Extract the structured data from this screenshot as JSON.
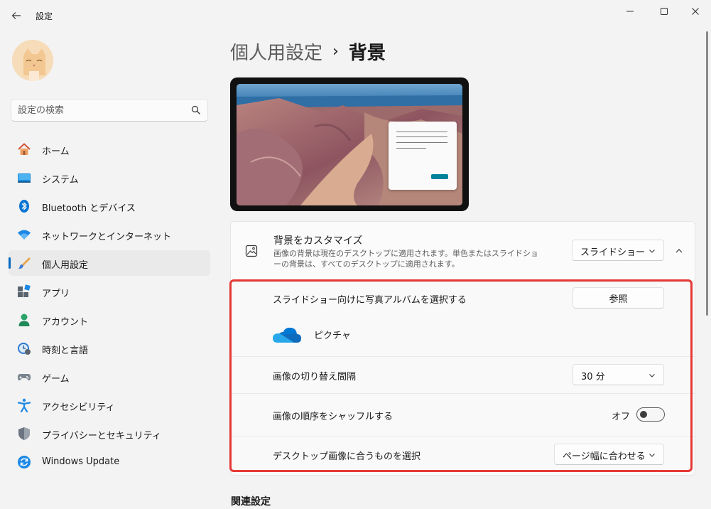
{
  "window": {
    "title": "設定",
    "back_icon": "arrow-left-icon",
    "controls": [
      "minimize-icon",
      "maximize-icon",
      "close-icon"
    ]
  },
  "sidebar": {
    "search": {
      "placeholder": "設定の検索",
      "value": ""
    },
    "items": [
      {
        "label": "ホーム",
        "icon": "home-icon"
      },
      {
        "label": "システム",
        "icon": "system-icon"
      },
      {
        "label": "Bluetooth とデバイス",
        "icon": "bluetooth-icon"
      },
      {
        "label": "ネットワークとインターネット",
        "icon": "wifi-icon"
      },
      {
        "label": "個人用設定",
        "icon": "brush-icon",
        "active": true
      },
      {
        "label": "アプリ",
        "icon": "apps-icon"
      },
      {
        "label": "アカウント",
        "icon": "account-icon"
      },
      {
        "label": "時刻と言語",
        "icon": "time-language-icon"
      },
      {
        "label": "ゲーム",
        "icon": "gamepad-icon"
      },
      {
        "label": "アクセシビリティ",
        "icon": "accessibility-icon"
      },
      {
        "label": "プライバシーとセキュリティ",
        "icon": "shield-icon"
      },
      {
        "label": "Windows Update",
        "icon": "windows-update-icon"
      }
    ]
  },
  "main": {
    "breadcrumb": {
      "parent": "個人用設定",
      "separator": "›",
      "current": "背景"
    },
    "customize": {
      "title": "背景をカスタマイズ",
      "description": "画像の背景は現在のデスクトップに適用されます。単色またはスライドショーの背景は、すべてのデスクトップに適用されます。",
      "dropdown_value": "スライドショー"
    },
    "rows": {
      "album": {
        "label": "スライドショー向けに写真アルバムを選択する",
        "button": "参照",
        "album_name": "ピクチャ"
      },
      "interval": {
        "label": "画像の切り替え間隔",
        "value": "30 分"
      },
      "shuffle": {
        "label": "画像の順序をシャッフルする",
        "state": "オフ"
      },
      "fit": {
        "label": "デスクトップ画像に合うものを選択",
        "value": "ページ幅に合わせる"
      }
    },
    "related": "関連設定"
  },
  "colors": {
    "accent": "#0067c0",
    "highlight": "#e53935"
  }
}
